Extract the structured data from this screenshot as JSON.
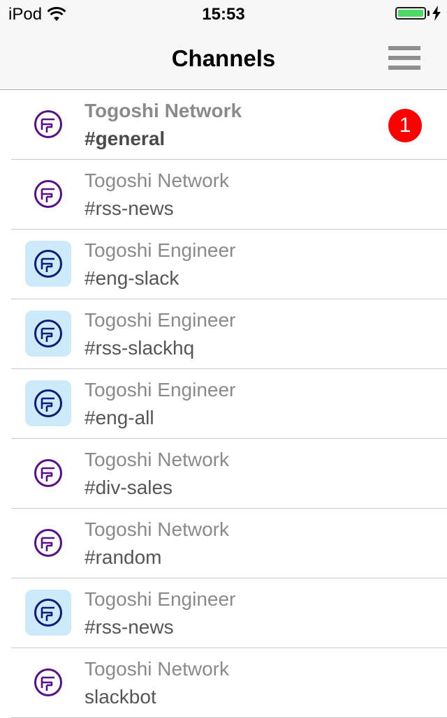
{
  "status_bar": {
    "carrier": "iPod",
    "time": "15:53",
    "battery_percent": 100,
    "battery_color": "#4cd964",
    "icons": [
      "wifi-icon",
      "battery-icon",
      "charging-bolt-icon"
    ]
  },
  "nav": {
    "title": "Channels",
    "menu_icon": "hamburger-menu-icon"
  },
  "colors": {
    "badge": "#ff0000",
    "network_icon": "#5a0f8a",
    "engineer_icon": "#0d1b7a",
    "engineer_tile": "#cdeafa"
  },
  "channels": [
    {
      "team": "Togoshi Network",
      "channel": "#general",
      "icon": "network-team-icon",
      "badge": "1",
      "unread": true
    },
    {
      "team": "Togoshi Network",
      "channel": "#rss-news",
      "icon": "network-team-icon"
    },
    {
      "team": "Togoshi Engineer",
      "channel": "#eng-slack",
      "icon": "engineer-team-icon"
    },
    {
      "team": "Togoshi Engineer",
      "channel": "#rss-slackhq",
      "icon": "engineer-team-icon"
    },
    {
      "team": "Togoshi Engineer",
      "channel": "#eng-all",
      "icon": "engineer-team-icon"
    },
    {
      "team": "Togoshi Network",
      "channel": "#div-sales",
      "icon": "network-team-icon"
    },
    {
      "team": "Togoshi Network",
      "channel": "#random",
      "icon": "network-team-icon"
    },
    {
      "team": "Togoshi Engineer",
      "channel": "#rss-news",
      "icon": "engineer-team-icon"
    },
    {
      "team": "Togoshi Network",
      "channel": "slackbot",
      "icon": "network-team-icon"
    }
  ]
}
